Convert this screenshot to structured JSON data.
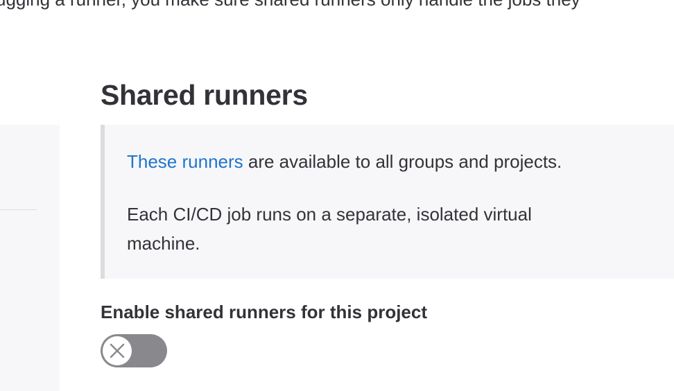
{
  "top_text": "ugging a runner, you make sure shared runners only handle the jobs they",
  "section": {
    "title": "Shared runners",
    "info": {
      "link_text": "These runners",
      "line1_rest": " are available to all groups and projects.",
      "line2": "Each CI/CD job runs on a separate, isolated virtual machine."
    },
    "toggle": {
      "label": "Enable shared runners for this project",
      "state": "off",
      "knob_icon": "close-icon"
    }
  },
  "colors": {
    "link": "#1f75cb",
    "text": "#333238",
    "toggle_off": "#89888d",
    "panel_bg": "#f7f7f9",
    "border": "#dcdcde"
  }
}
